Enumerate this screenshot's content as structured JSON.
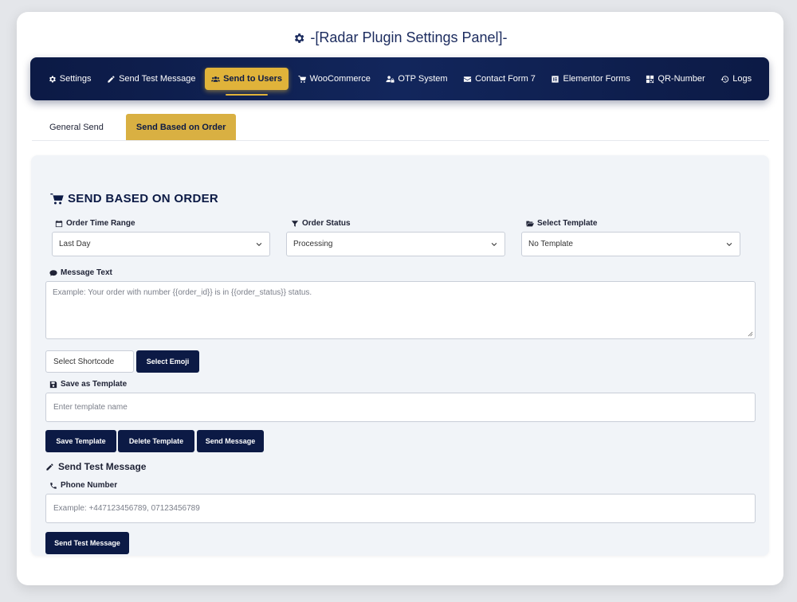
{
  "panel": {
    "title": "-[Radar Plugin Settings Panel]-",
    "icon": "gear-icon"
  },
  "nav": {
    "items": [
      {
        "label": "Settings",
        "icon": "gear-icon"
      },
      {
        "label": "Send Test Message",
        "icon": "pen-icon"
      },
      {
        "label": "Send to Users",
        "icon": "users-icon",
        "active": true
      },
      {
        "label": "WooCommerce",
        "icon": "cart-icon"
      },
      {
        "label": "OTP System",
        "icon": "user-lock-icon"
      },
      {
        "label": "Contact Form 7",
        "icon": "envelope-icon"
      },
      {
        "label": "Elementor Forms",
        "icon": "elementor-icon"
      },
      {
        "label": "QR-Number",
        "icon": "qrcode-icon"
      },
      {
        "label": "Logs",
        "icon": "history-icon"
      }
    ]
  },
  "subtabs": [
    {
      "label": "General Send"
    },
    {
      "label": "Send Based on Order",
      "active": true
    }
  ],
  "section": {
    "title": "SEND BASED ON ORDER",
    "order_time_range": {
      "label": "Order Time Range",
      "value": "Last Day"
    },
    "order_status": {
      "label": "Order Status",
      "value": "Processing"
    },
    "select_template": {
      "label": "Select Template",
      "value": "No Template"
    },
    "message_text": {
      "label": "Message Text",
      "placeholder": "Example: Your order with number {{order_id}} is in {{order_status}} status."
    },
    "shortcode": {
      "value": "Select Shortcode"
    },
    "emoji_button": "Select Emoji",
    "save_as_template": {
      "label": "Save as Template",
      "placeholder": "Enter template name"
    },
    "buttons": {
      "save_template": "Save Template",
      "delete_template": "Delete Template",
      "send_message": "Send Message"
    }
  },
  "test_message": {
    "title": "Send Test Message",
    "phone": {
      "label": "Phone Number",
      "placeholder": "Example: +447123456789, 07123456789"
    },
    "button": "Send Test Message"
  },
  "colors": {
    "navy": "#0c1a45",
    "gold": "#e0b33a",
    "background": "#e4e6ea"
  }
}
